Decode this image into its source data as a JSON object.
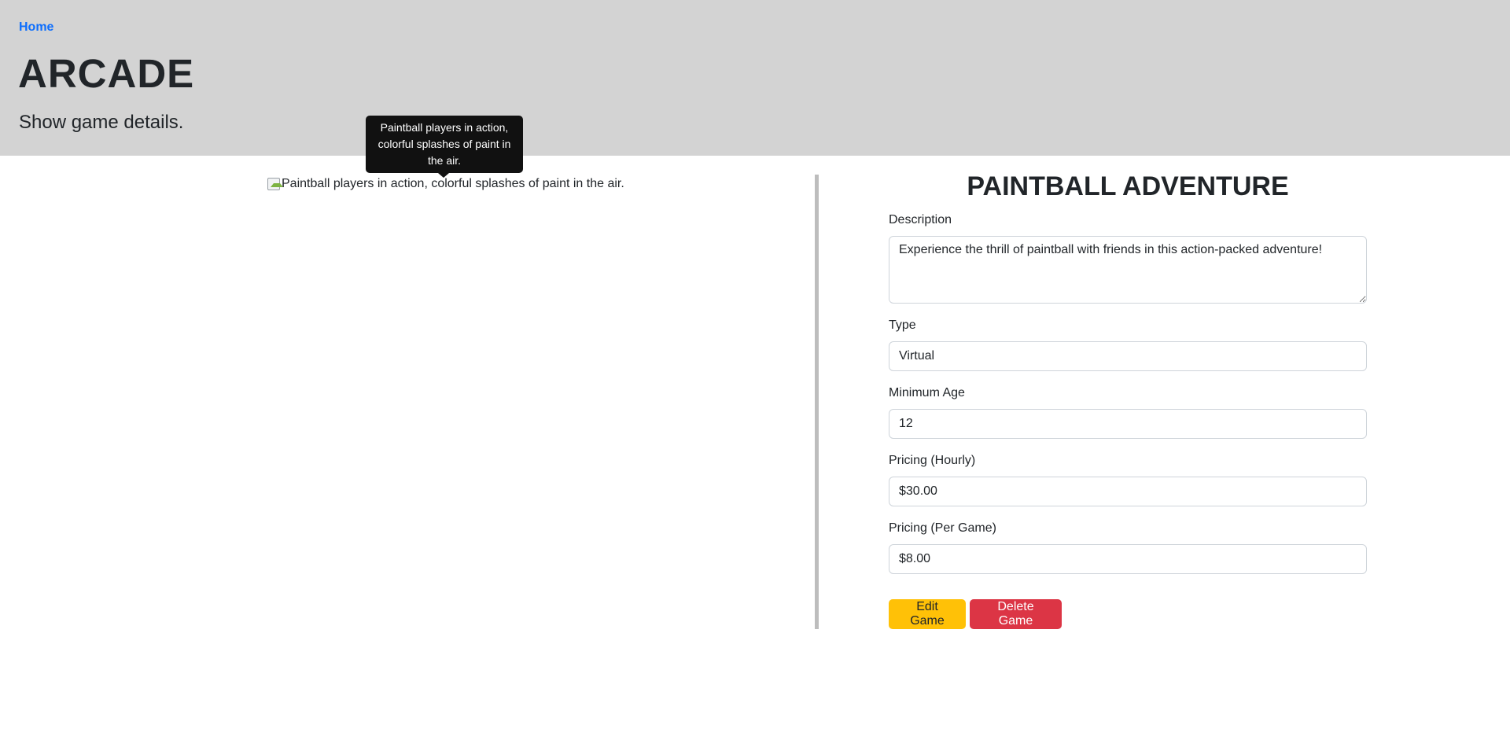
{
  "header": {
    "home_link": "Home",
    "title": "ARCADE",
    "subtitle": "Show game details."
  },
  "tooltip": {
    "text": "Paintball players in action, colorful splashes of paint in the air."
  },
  "image": {
    "alt": "Paintball players in action, colorful splashes of paint in the air."
  },
  "game": {
    "name": "PAINTBALL ADVENTURE",
    "fields": {
      "description": {
        "label": "Description",
        "value": "Experience the thrill of paintball with friends in this action-packed adventure!"
      },
      "type": {
        "label": "Type",
        "value": "Virtual"
      },
      "minimum_age": {
        "label": "Minimum Age",
        "value": "12"
      },
      "pricing_hourly": {
        "label": "Pricing (Hourly)",
        "value": "$30.00"
      },
      "pricing_per_game": {
        "label": "Pricing (Per Game)",
        "value": "$8.00"
      }
    },
    "buttons": {
      "edit": "Edit Game",
      "delete": "Delete Game"
    }
  },
  "colors": {
    "header_bg": "#d3d3d3",
    "link": "#0d6efd",
    "edit_button": "#ffc107",
    "delete_button": "#dc3545",
    "divider": "#bdbdbd"
  }
}
